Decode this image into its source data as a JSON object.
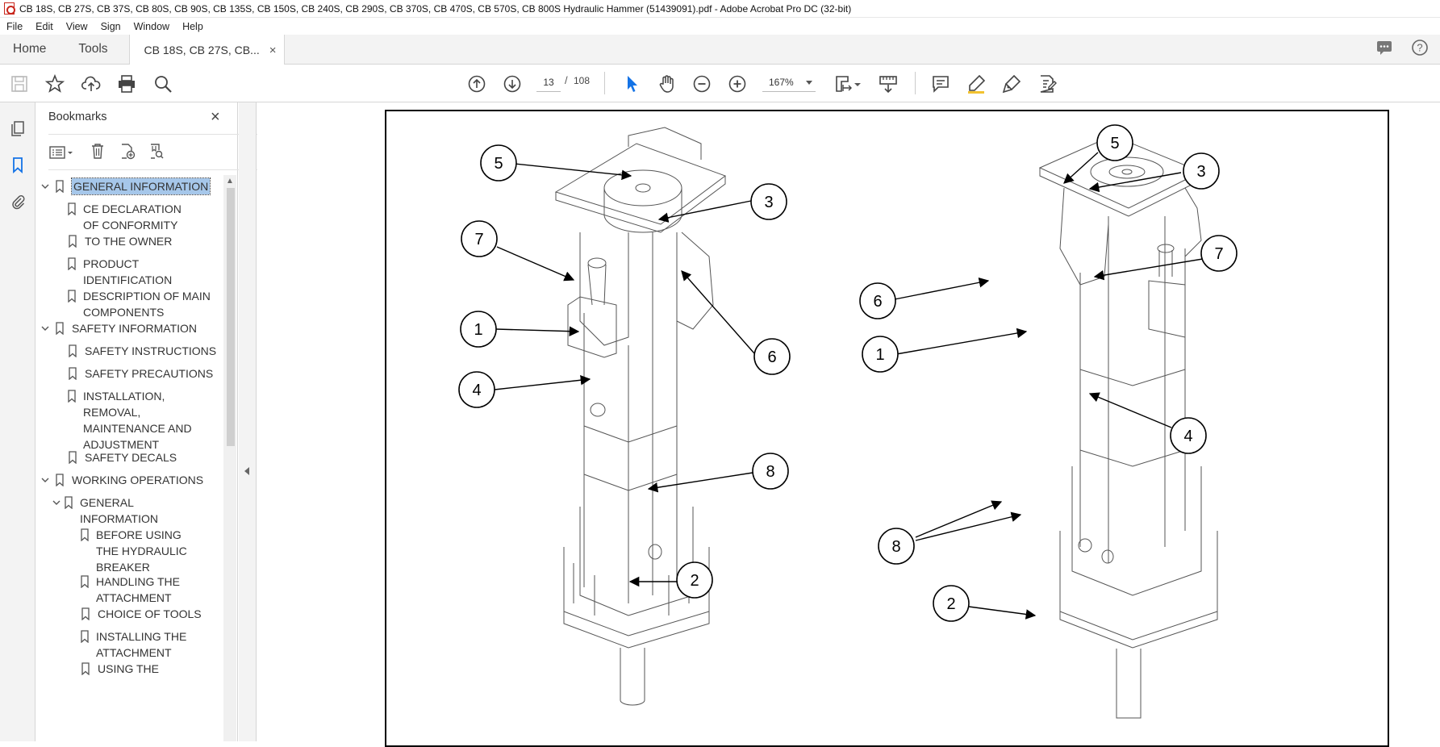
{
  "window": {
    "title": "CB 18S, CB 27S, CB 37S, CB 80S, CB 90S, CB 135S, CB 150S, CB 240S, CB 290S, CB 370S, CB 470S, CB 570S, CB 800S Hydraulic Hammer (51439091).pdf - Adobe Acrobat Pro DC (32-bit)"
  },
  "menu": [
    "File",
    "Edit",
    "View",
    "Sign",
    "Window",
    "Help"
  ],
  "tabs": {
    "home": "Home",
    "tools": "Tools",
    "document": "CB 18S, CB 27S, CB...",
    "close_glyph": "×"
  },
  "toolbar": {
    "page_current": "13",
    "page_sep": "/",
    "page_total": "108",
    "zoom": "167%"
  },
  "bookmarks": {
    "title": "Bookmarks",
    "close_glyph": "×",
    "items": [
      {
        "label": "GENERAL INFORMATION",
        "level": 0,
        "expanded": true,
        "selected": true
      },
      {
        "label": "CE DECLARATION OF CONFORMITY",
        "level": 1
      },
      {
        "label": "TO THE OWNER",
        "level": 1
      },
      {
        "label": "PRODUCT IDENTIFICATION",
        "level": 1
      },
      {
        "label": "DESCRIPTION OF MAIN COMPONENTS",
        "level": 1
      },
      {
        "label": "SAFETY INFORMATION",
        "level": 0,
        "expanded": true
      },
      {
        "label": "SAFETY INSTRUCTIONS",
        "level": 1
      },
      {
        "label": "SAFETY PRECAUTIONS",
        "level": 1
      },
      {
        "label": "INSTALLATION, REMOVAL, MAINTENANCE AND ADJUSTMENT",
        "level": 1
      },
      {
        "label": "SAFETY DECALS",
        "level": 1
      },
      {
        "label": "WORKING OPERATIONS",
        "level": 0,
        "expanded": true
      },
      {
        "label": "GENERAL INFORMATION",
        "level": 1,
        "expanded": true
      },
      {
        "label": "BEFORE USING THE HYDRAULIC BREAKER",
        "level": 2
      },
      {
        "label": "HANDLING THE ATTACHMENT",
        "level": 2
      },
      {
        "label": "CHOICE OF TOOLS",
        "level": 2
      },
      {
        "label": "INSTALLING THE ATTACHMENT",
        "level": 2
      },
      {
        "label": "USING THE",
        "level": 2
      }
    ]
  },
  "diagram": {
    "left_callouts": [
      "5",
      "3",
      "7",
      "1",
      "6",
      "4",
      "8",
      "2"
    ],
    "right_callouts": [
      "5",
      "3",
      "7",
      "6",
      "1",
      "4",
      "8",
      "2"
    ]
  },
  "colors": {
    "accent_blue": "#1473e6",
    "selection": "#a6c7ea",
    "acrobat_red": "#c8261c"
  }
}
